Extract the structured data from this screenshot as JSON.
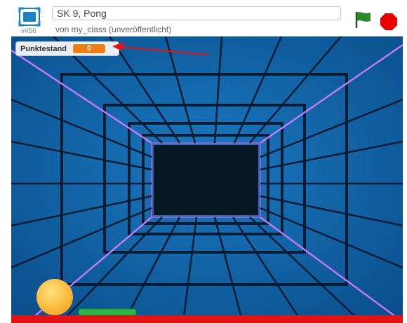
{
  "project": {
    "title": "SK 9, Pong",
    "byline": "von my_class (unveröffentlicht)",
    "version": "v456"
  },
  "controls": {
    "fullscreen_icon": "fullscreen-icon",
    "green_flag_icon": "green-flag-icon",
    "stop_icon": "stop-sign-icon",
    "flag_color": "#2a8a2a",
    "stop_color": "#e60000"
  },
  "monitor": {
    "label": "Punktestand",
    "value": "0",
    "value_color": "#ee7d16"
  },
  "stage": {
    "background": "#0d5fa0",
    "ball_color": "#f5a623",
    "paddle_color": "#2db54a",
    "floor_color": "#e01414",
    "annotation_color": "#e01414"
  }
}
